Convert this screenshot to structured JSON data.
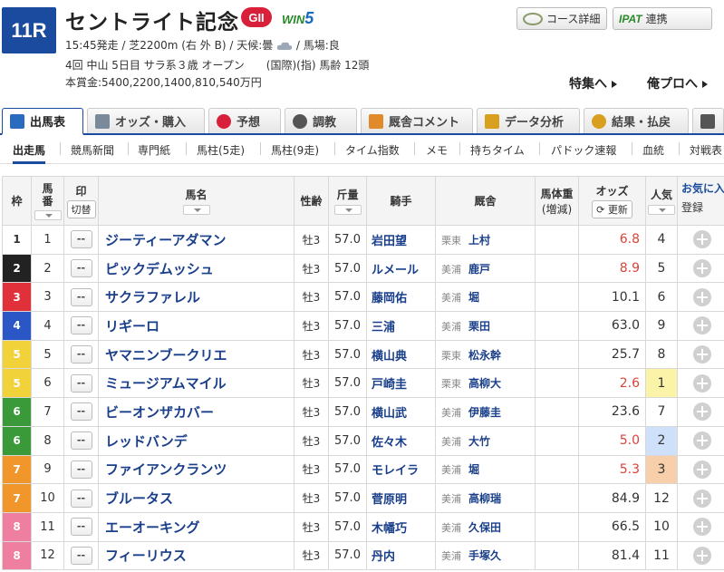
{
  "header": {
    "race_number": "11R",
    "race_name": "セントライト記念",
    "grade": "GII",
    "win5_prefix": "WIN",
    "win5_suffix": "5",
    "info_line1": "15:45発走 / 芝2200m (右 外 B) / 天候:曇",
    "info_line1_tail": " / 馬場:良",
    "info_line2": "4回 中山 5日目 サラ系３歳 オープン　　(国際)(指) 馬齢 12頭",
    "info_line3": "本賞金:5400,2200,1400,810,540万円",
    "weather_icon": "cloud-icon",
    "course_button": "コース詳細",
    "ipat_logo": "IPAT",
    "ipat_button": "連携",
    "special_link": "特集へ",
    "orepro_link": "俺プロへ"
  },
  "tabs": [
    {
      "label": "出馬表",
      "color": "#2a6bc0"
    },
    {
      "label": "オッズ・購入",
      "color": "#7a8a9a"
    },
    {
      "label": "予想",
      "color": "#d9203a"
    },
    {
      "label": "調教",
      "color": "#555555"
    },
    {
      "label": "厩舎コメント",
      "color": "#e08a2a"
    },
    {
      "label": "データ分析",
      "color": "#d9a020"
    },
    {
      "label": "結果・払戻",
      "color": "#d9a020"
    },
    {
      "label": "",
      "color": "#555555"
    }
  ],
  "subnav": [
    "出走馬",
    "競馬新聞",
    "専門紙",
    "馬柱(5走)",
    "馬柱(9走)",
    "タイム指数",
    "メモ",
    "持ちタイム",
    "パドック速報",
    "血統",
    "対戦表"
  ],
  "table": {
    "headers": {
      "waku": "枠",
      "umaban": "馬番",
      "mark": "印",
      "mark_toggle": "切替",
      "name": "馬名",
      "sexage": "性齢",
      "weight": "斤量",
      "jockey": "騎手",
      "stable": "厩舎",
      "bodyweight": "馬体重",
      "bodyweight_sub": "(増減)",
      "odds": "オッズ",
      "odds_update": "更新",
      "ninki": "人気",
      "favorite": "お気に入",
      "register": "登録"
    },
    "mark_placeholder": "--",
    "rows": [
      {
        "waku": "1",
        "umaban": "1",
        "name": "ジーティーアダマン",
        "sexage": "牡3",
        "weight": "57.0",
        "jockey": "岩田望",
        "area": "栗東",
        "trainer": "上村",
        "odds": "6.8",
        "ninki": "4"
      },
      {
        "waku": "2",
        "umaban": "2",
        "name": "ピックデムッシュ",
        "sexage": "牡3",
        "weight": "57.0",
        "jockey": "ルメール",
        "area": "美浦",
        "trainer": "鹿戸",
        "odds": "8.9",
        "ninki": "5"
      },
      {
        "waku": "3",
        "umaban": "3",
        "name": "サクラファレル",
        "sexage": "牡3",
        "weight": "57.0",
        "jockey": "藤岡佑",
        "area": "美浦",
        "trainer": "堀",
        "odds": "10.1",
        "ninki": "6"
      },
      {
        "waku": "4",
        "umaban": "4",
        "name": "リギーロ",
        "sexage": "牡3",
        "weight": "57.0",
        "jockey": "三浦",
        "area": "美浦",
        "trainer": "栗田",
        "odds": "63.0",
        "ninki": "9"
      },
      {
        "waku": "5",
        "umaban": "5",
        "name": "ヤマニンブークリエ",
        "sexage": "牡3",
        "weight": "57.0",
        "jockey": "横山典",
        "area": "栗東",
        "trainer": "松永幹",
        "odds": "25.7",
        "ninki": "8"
      },
      {
        "waku": "5",
        "umaban": "6",
        "name": "ミュージアムマイル",
        "sexage": "牡3",
        "weight": "57.0",
        "jockey": "戸崎圭",
        "area": "栗東",
        "trainer": "高柳大",
        "odds": "2.6",
        "ninki": "1"
      },
      {
        "waku": "6",
        "umaban": "7",
        "name": "ビーオンザカバー",
        "sexage": "牡3",
        "weight": "57.0",
        "jockey": "横山武",
        "area": "美浦",
        "trainer": "伊藤圭",
        "odds": "23.6",
        "ninki": "7"
      },
      {
        "waku": "6",
        "umaban": "8",
        "name": "レッドバンデ",
        "sexage": "牡3",
        "weight": "57.0",
        "jockey": "佐々木",
        "area": "美浦",
        "trainer": "大竹",
        "odds": "5.0",
        "ninki": "2"
      },
      {
        "waku": "7",
        "umaban": "9",
        "name": "ファイアンクランツ",
        "sexage": "牡3",
        "weight": "57.0",
        "jockey": "モレイラ",
        "area": "美浦",
        "trainer": "堀",
        "odds": "5.3",
        "ninki": "3"
      },
      {
        "waku": "7",
        "umaban": "10",
        "name": "ブルータス",
        "sexage": "牡3",
        "weight": "57.0",
        "jockey": "菅原明",
        "area": "美浦",
        "trainer": "高柳瑞",
        "odds": "84.9",
        "ninki": "12"
      },
      {
        "waku": "8",
        "umaban": "11",
        "name": "エーオーキング",
        "sexage": "牡3",
        "weight": "57.0",
        "jockey": "木幡巧",
        "area": "美浦",
        "trainer": "久保田",
        "odds": "66.5",
        "ninki": "10"
      },
      {
        "waku": "8",
        "umaban": "12",
        "name": "フィーリウス",
        "sexage": "牡3",
        "weight": "57.0",
        "jockey": "丹内",
        "area": "美浦",
        "trainer": "手塚久",
        "odds": "81.4",
        "ninki": "11"
      }
    ]
  },
  "colors": {
    "waku": {
      "1": {
        "bg": "#ffffff",
        "fg": "#333333"
      },
      "2": {
        "bg": "#222222",
        "fg": "#ffffff"
      },
      "3": {
        "bg": "#e0303a",
        "fg": "#ffffff"
      },
      "4": {
        "bg": "#2a56c6",
        "fg": "#ffffff"
      },
      "5": {
        "bg": "#f2d23a",
        "fg": "#ffffff"
      },
      "6": {
        "bg": "#3a9a3a",
        "fg": "#ffffff"
      },
      "7": {
        "bg": "#f0962a",
        "fg": "#ffffff"
      },
      "8": {
        "bg": "#ef7fa0",
        "fg": "#ffffff"
      }
    },
    "odds_hot": "#d9443a",
    "odds_normal": "#333333",
    "ninki_1": "#fbf3a8",
    "ninki_2": "#cfe0fb",
    "ninki_3": "#f7cfaa"
  }
}
